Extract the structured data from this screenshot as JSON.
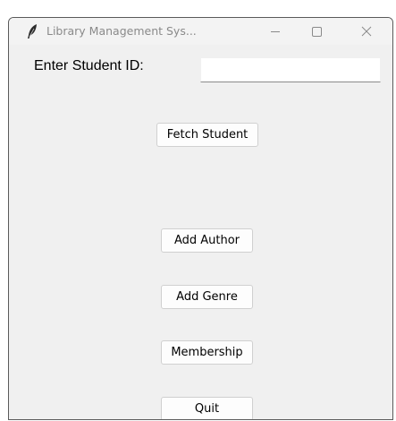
{
  "window": {
    "title": "Library Management Sys...",
    "controls": {
      "minimize_icon": "minimize-icon",
      "maximize_icon": "maximize-icon",
      "close_icon": "close-icon"
    }
  },
  "form": {
    "student_id_label": "Enter Student ID:",
    "student_id_value": "",
    "fetch_button_label": "Fetch Student"
  },
  "buttons": {
    "add_author": "Add Author",
    "add_genre": "Add Genre",
    "membership": "Membership",
    "quit": "Quit"
  },
  "colors": {
    "window_background": "#f0f0f0",
    "button_background": "#fdfdfd",
    "button_border": "#d0d0d0",
    "title_text": "#8a8a8a"
  }
}
